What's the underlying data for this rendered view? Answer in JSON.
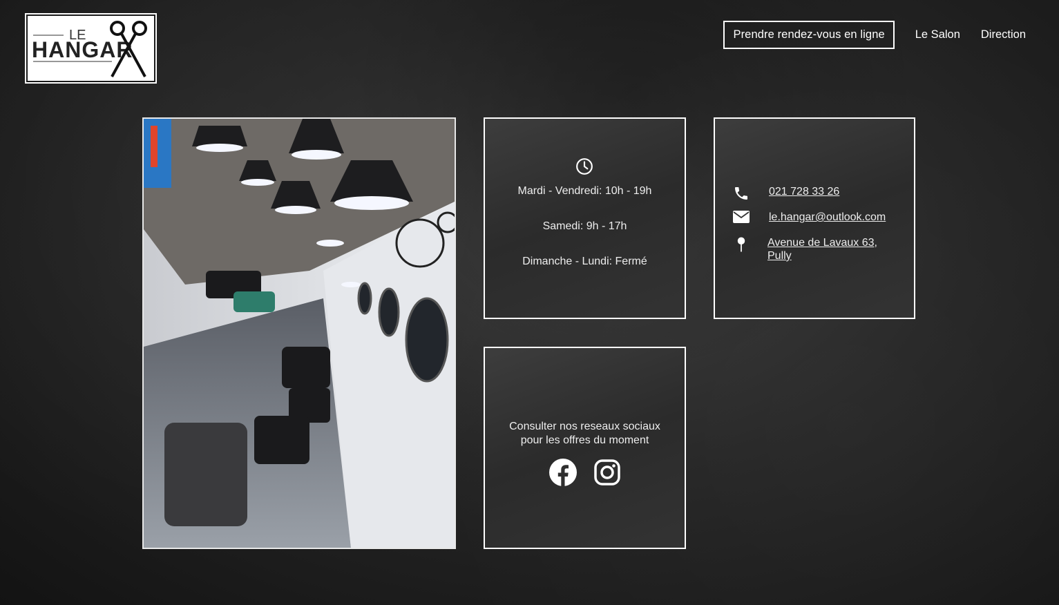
{
  "header": {
    "logo_alt": "LE HANGAR",
    "logo_top": "LE",
    "logo_main": "HANGAR",
    "nav": {
      "cta_label": "Prendre rendez-vous en ligne",
      "salon_label": "Le Salon",
      "direction_label": "Direction"
    }
  },
  "hours": {
    "icon": "clock-icon",
    "lines": [
      "Mardi - Vendredi: 10h - 19h",
      "Samedi: 9h - 17h",
      "Dimanche - Lundi: Fermé"
    ]
  },
  "contact": {
    "phone": "021 728 33 26",
    "email": "le.hangar@outlook.com",
    "address_line1": "Avenue de Lavaux 63,",
    "address_line2": "Pully",
    "icons": [
      "phone-icon",
      "mail-icon",
      "map-pin-icon"
    ]
  },
  "social": {
    "text_line1": "Consulter nos reseaux sociaux",
    "text_line2": "pour les offres du moment",
    "icons": [
      "facebook-icon",
      "instagram-icon"
    ]
  },
  "colors": {
    "text": "#f2f2f2",
    "border": "#ffffff",
    "background": "#252525"
  }
}
